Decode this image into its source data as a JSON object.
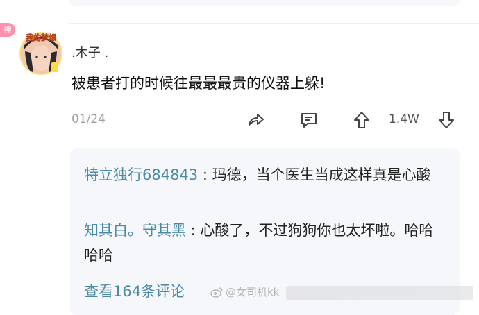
{
  "badge": "神",
  "avatar": {
    "caption": "我的梦想"
  },
  "comment": {
    "username": ".木子 .",
    "text": "被患者打的时候往最最最贵的仪器上躲!",
    "counter": "01/24",
    "like_count": "1.4W"
  },
  "replies": [
    {
      "name": "特立独行684843",
      "separator": " : ",
      "text": "玛德，当个医生当成这样真是心酸"
    },
    {
      "name": "知其白。守其黑",
      "separator": " : ",
      "text": "心酸了，不过狗狗你也太坏啦。哈哈哈哈"
    }
  ],
  "view_more": "查看164条评论",
  "watermark": "@女司机kk",
  "icons": [
    "share-icon",
    "comment-icon",
    "upvote-icon",
    "downvote-icon",
    "weibo-icon"
  ],
  "colors": {
    "accent": "#4a8aa6",
    "badge": "#ff8fae",
    "panel": "#f6f7fa"
  }
}
